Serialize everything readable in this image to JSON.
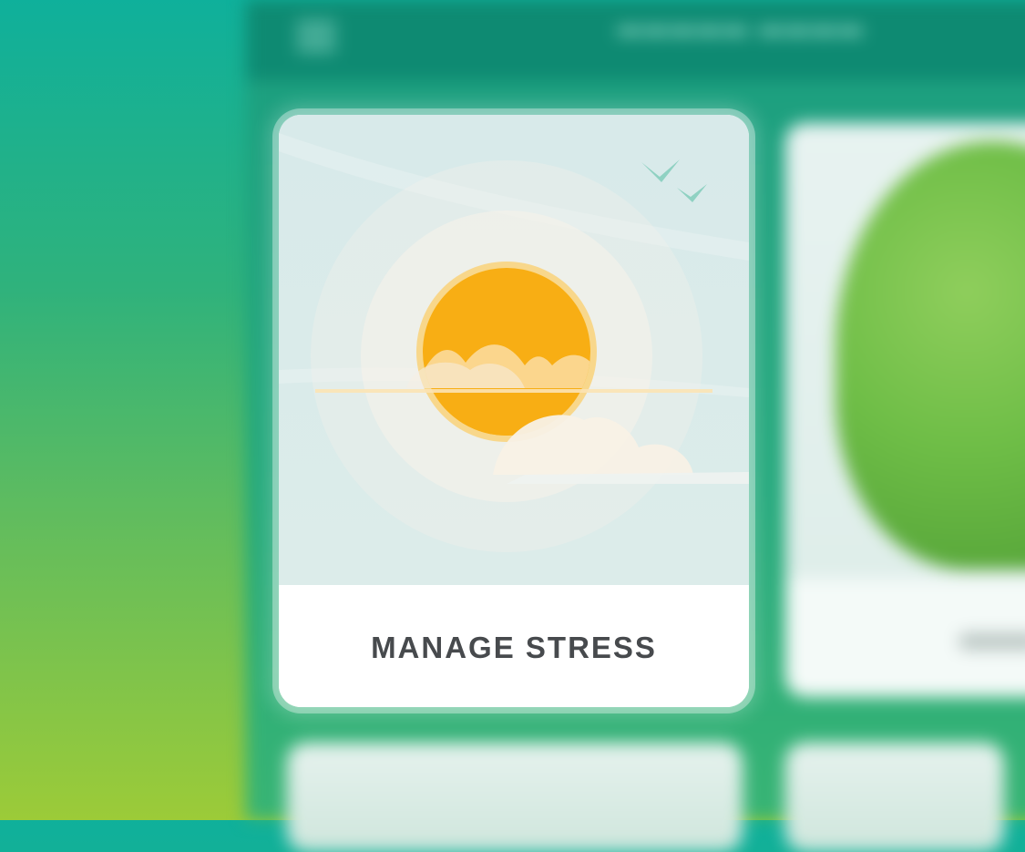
{
  "card": {
    "title": "MANAGE STRESS"
  },
  "colors": {
    "sun": "#f8ae14",
    "sky": "#d9ebeb",
    "bird": "#8fd1c2",
    "title_text": "#474a4d"
  },
  "icons": {
    "menu": "hamburger-menu-icon",
    "birds": "birds-icon"
  }
}
